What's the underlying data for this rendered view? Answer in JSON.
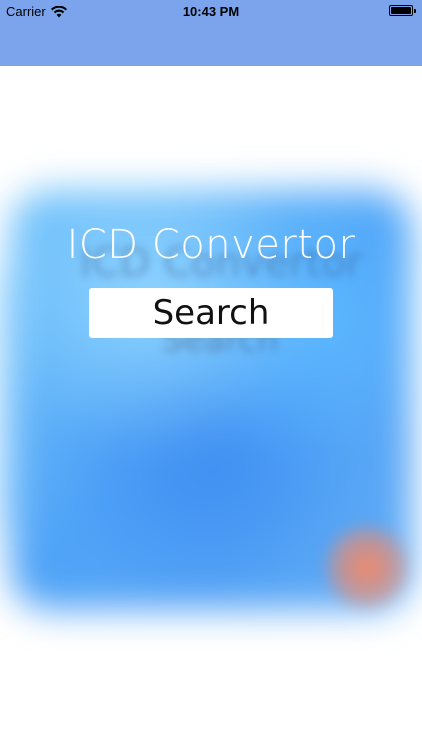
{
  "status_bar": {
    "carrier": "Carrier",
    "time": "10:43 PM",
    "wifi_icon": "wifi-icon",
    "battery_icon": "battery-icon"
  },
  "app": {
    "title": "ICD Convertor",
    "search_label": "Search"
  },
  "colors": {
    "nav_bar": "#7ba4ec",
    "hero_blue": "#4fa3f7",
    "accent_orange": "#f08a6a"
  }
}
